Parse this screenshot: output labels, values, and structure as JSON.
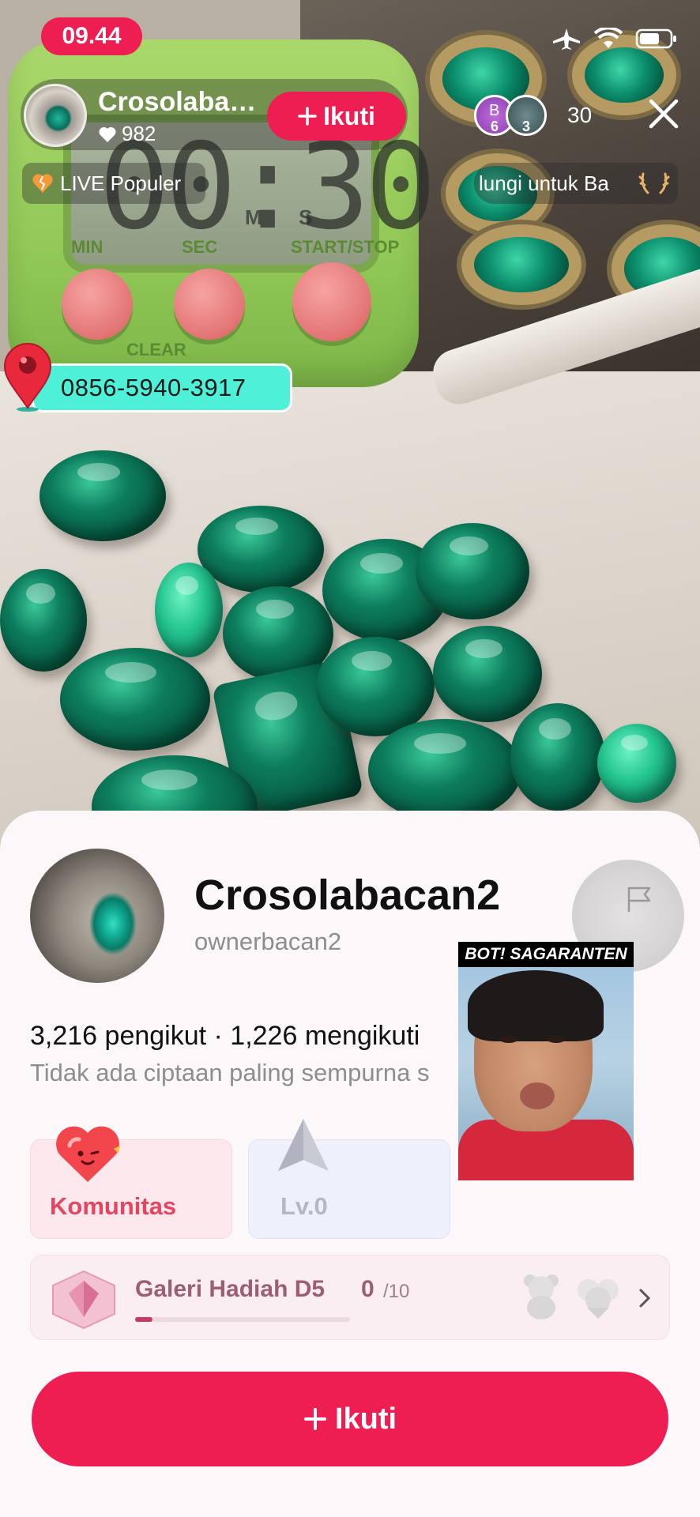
{
  "status_bar": {
    "time": "09.44"
  },
  "live_header": {
    "host_name": "Crosolabacan2",
    "likes": "982",
    "follow_label": "Ikuti",
    "viewers": [
      {
        "letter": "B",
        "badge": "6"
      },
      {
        "letter": "",
        "badge": "3"
      }
    ],
    "viewer_count": "30",
    "live_badge": "LIVE Populer",
    "ticker_text": "lungi untuk Ba"
  },
  "phone_tag": "0856-5940-3917",
  "profile": {
    "name": "Crosolabacan2",
    "handle": "ownerbacan2",
    "stats": "3,216 pengikut · 1,226 mengikuti",
    "bio": "Tidak ada ciptaan paling sempurna s"
  },
  "pip_overlay": {
    "label": "BOT! SAGARANTEN"
  },
  "cards": {
    "community_label": "Komunitas",
    "level_label": "Lv.0"
  },
  "gallery": {
    "title": "Galeri Hadiah D5",
    "count": "0",
    "total": "/10",
    "progress": 0.08
  },
  "follow_button": {
    "label": "Ikuti"
  },
  "colors": {
    "accent": "#ee1d52",
    "phone_tag_bg": "#4ff0d8"
  }
}
